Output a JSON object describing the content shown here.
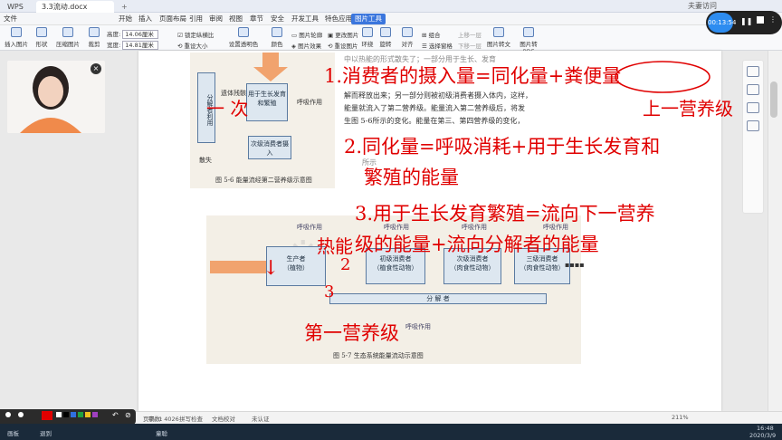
{
  "window": {
    "app_tab": "WPS",
    "doc_tab": "3.3流动.docx",
    "user_label": "夫妻访问"
  },
  "menu": [
    "文件",
    "开始",
    "插入",
    "页面布局",
    "引用",
    "审阅",
    "视图",
    "章节",
    "安全",
    "开发工具",
    "特色应用",
    "图片工具"
  ],
  "ribbon": {
    "insert_image": "插入图片",
    "shape": "形状",
    "compress": "压缩图片",
    "crop": "裁剪",
    "height_label": "高度:",
    "height_value": "14.06厘米",
    "width_label": "宽度:",
    "width_value": "14.81厘米",
    "lock_ratio": "锁定纵横比",
    "reset_size": "重设大小",
    "set_transparent": "设置透明色",
    "color": "颜色",
    "outline": "图片轮廓",
    "effect": "图片效果",
    "change_image": "更改图片",
    "reset_image": "重设图片",
    "wrap": "环绕",
    "rotate": "旋转",
    "align": "对齐",
    "combine": "组合",
    "up_layer": "上移一层",
    "down_layer": "下移一层",
    "select_pane": "选择窗格",
    "img_to_text": "图片转文字",
    "img_to_pdf": "图片转PDF"
  },
  "fig56": {
    "caption": "图 5-6    能量流经第二营养级示意图",
    "box_feces": "分解者利用",
    "box_growth": "用于生长发育和繁殖",
    "box_secondary": "次级消费者摄入",
    "lbl_respiration": "呼吸作用",
    "lbl_remains": "遗体残骸",
    "lbl_dissipate": "散失"
  },
  "body_text": [
    "中以热能的形式散失了；一部分用于生长、发育",
    "解而释放出来；另一部分则被初级消费者摄入体内，这样，",
    "能量就流入了第二营养级。能量流入第二营养级后，将发",
    "生图 5-6所示的变化。能量在第三、第四营养级的变化，",
    "所示"
  ],
  "fig57": {
    "caption": "图 5-7    生态系统能量流动示意图",
    "producer": "生产者",
    "producer_sub": "（植物）",
    "primary": "初级消费者",
    "primary_sub": "（植食性动物）",
    "secondary": "次级消费者",
    "secondary_sub": "（肉食性动物）",
    "tertiary": "三级消费者",
    "tertiary_sub": "（肉食性动物）",
    "decomposer": "分 解 者",
    "respiration": "呼吸作用"
  },
  "ink": {
    "line1": "1.消费者的摄入量=同化量+粪便量",
    "line1b": "上一营养级",
    "line1c": "一 次",
    "line2": "2.同化量=呼吸消耗+用于生长发育和",
    "line2b": "繁殖的能量",
    "line3": "3.用于生长发育繁殖=流向下一营养",
    "line3b": "级的能量+流向分解者的能量",
    "heat": "热能",
    "n2": "2",
    "n3": "3",
    "first_level": "第一营养级"
  },
  "recorder": {
    "time": "00:13:54"
  },
  "status": {
    "pages": "页码: 1",
    "words": "字数: 4026",
    "spell": "拼写检查",
    "proof": "文档校对",
    "cert": "未认证",
    "zoom": "211%"
  },
  "taskbar": {
    "items": [
      "画板",
      "退到",
      "童聪"
    ],
    "clock_time": "16:48",
    "clock_date": "2020/3/9"
  },
  "colors": {
    "ink": "#e00000",
    "accent": "#3b76dd",
    "orange_arrow": "#f1a36e",
    "box_blue": "#dde7f0"
  }
}
